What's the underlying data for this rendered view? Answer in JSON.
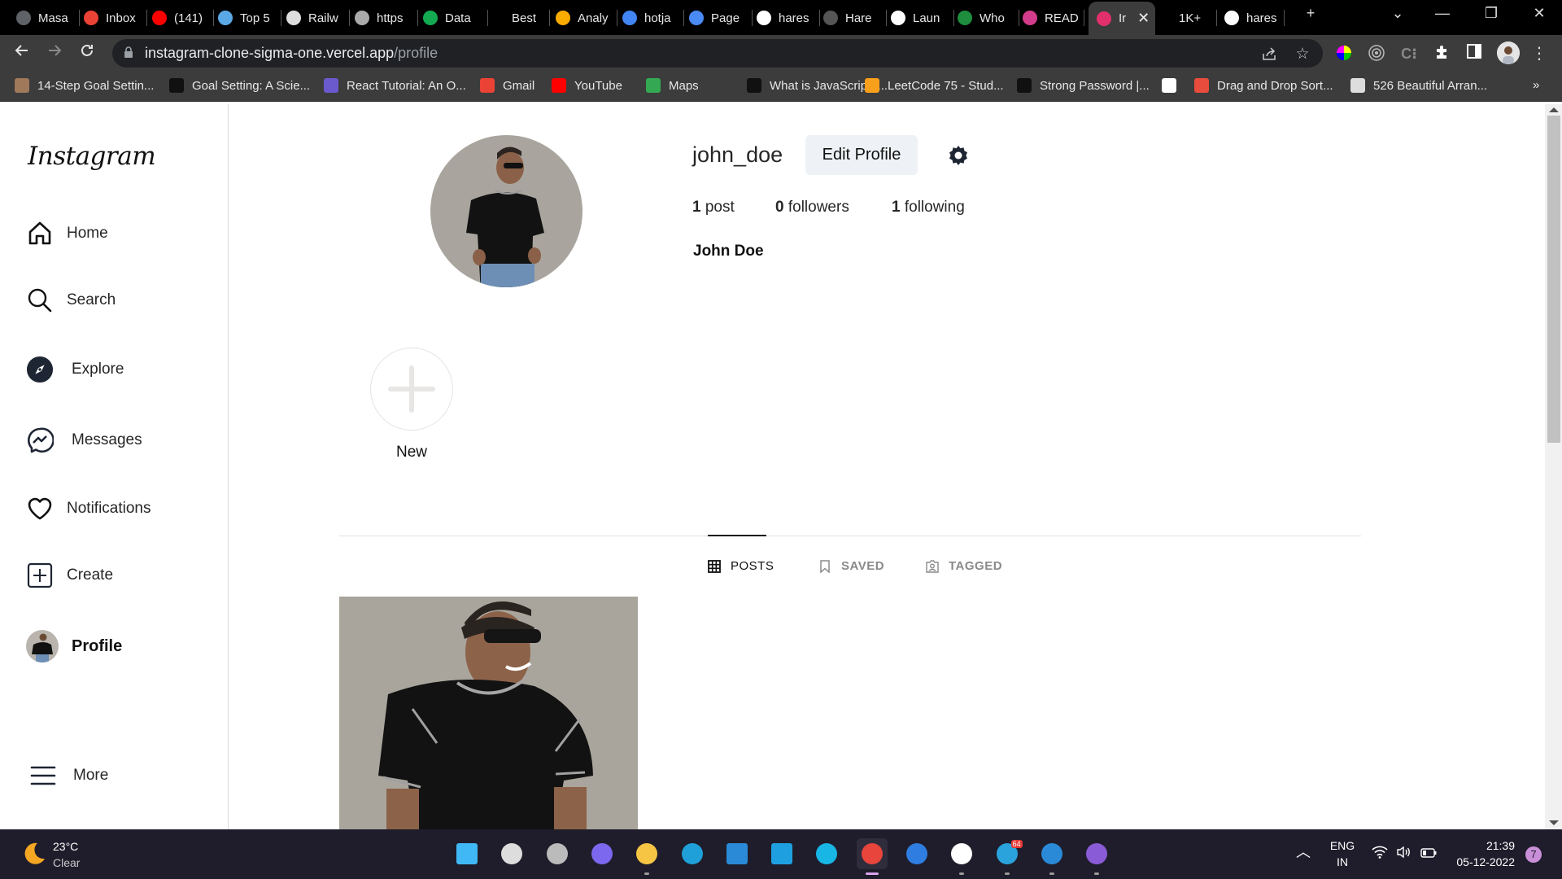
{
  "browser": {
    "tabs": [
      {
        "label": "Masa",
        "icon": "globe-icon",
        "color": "#5f6368"
      },
      {
        "label": "Inbox",
        "icon": "gmail-icon",
        "color": "#ea4335"
      },
      {
        "label": "(141)",
        "icon": "youtube-icon",
        "color": "#ff0000"
      },
      {
        "label": "Top 5",
        "icon": "mountain-icon",
        "color": "#5aa9e6"
      },
      {
        "label": "Railw",
        "icon": "railway-icon",
        "color": "#ddd"
      },
      {
        "label": "https",
        "icon": "film-reel-icon",
        "color": "#aaa"
      },
      {
        "label": "Data",
        "icon": "mongodb-leaf-icon",
        "color": "#13aa52"
      },
      {
        "label": "Best",
        "icon": "blank-icon",
        "color": "#000"
      },
      {
        "label": "Analy",
        "icon": "analytics-icon",
        "color": "#f9ab00"
      },
      {
        "label": "hotja",
        "icon": "google-icon",
        "color": "#4285f4"
      },
      {
        "label": "Page",
        "icon": "pagespeed-icon",
        "color": "#4a8af4"
      },
      {
        "label": "hares",
        "icon": "github-icon",
        "color": "#fff"
      },
      {
        "label": "Hare",
        "icon": "hashnode-icon",
        "color": "#555"
      },
      {
        "label": "Laun",
        "icon": "m-logo-icon",
        "color": "#fff"
      },
      {
        "label": "Who",
        "icon": "plus-cross-icon",
        "color": "#1e8e3e"
      },
      {
        "label": "READ",
        "icon": "readme-icon",
        "color": "#d33c8a"
      },
      {
        "label": "Ir",
        "icon": "instagram-icon",
        "color": "#e1306c",
        "active": true
      },
      {
        "label": "1K+",
        "icon": "blank-icon",
        "color": "#000"
      },
      {
        "label": "hares",
        "icon": "github-icon",
        "color": "#fff"
      }
    ],
    "new_tab": "+",
    "tab_search": "⌄",
    "window_controls": {
      "minimize": "—",
      "maximize": "❐",
      "close": "✕"
    },
    "url_host": "instagram-clone-sigma-one.vercel.app",
    "url_path": "/profile",
    "bookmarks": [
      {
        "label": "14-Step Goal Settin...",
        "icon": "person-photo-icon",
        "color": "#a0785a"
      },
      {
        "label": "Goal Setting: A Scie...",
        "icon": "jc-logo-icon",
        "color": "#111"
      },
      {
        "label": "React Tutorial: An O...",
        "icon": "floppy-disk-icon",
        "color": "#6a5acd"
      },
      {
        "label": "Gmail",
        "icon": "gmail-icon",
        "color": "#ea4335"
      },
      {
        "label": "YouTube",
        "icon": "youtube-icon",
        "color": "#ff0000"
      },
      {
        "label": "Maps",
        "icon": "maps-pin-icon",
        "color": "#34a853"
      },
      {
        "label": "What is JavaScript?...",
        "icon": "m-italic-icon",
        "color": "#111"
      },
      {
        "label": "LeetCode 75 - Stud...",
        "icon": "leetcode-icon",
        "color": "#f89f1b"
      },
      {
        "label": "Strong Password |...",
        "icon": "hi-logo-icon",
        "color": "#111"
      },
      {
        "label": "",
        "icon": "github-icon",
        "color": "#fff"
      },
      {
        "label": "Drag and Drop Sort...",
        "icon": "box-icon",
        "color": "#e74c3c"
      },
      {
        "label": "526 Beautiful Arran...",
        "icon": "globe-icon",
        "color": "#ddd"
      }
    ],
    "bookmarks_overflow": "»"
  },
  "sidebar": {
    "logo": "Instagram",
    "items": [
      {
        "label": "Home",
        "icon": "home-icon"
      },
      {
        "label": "Search",
        "icon": "search-icon"
      },
      {
        "label": "Explore",
        "icon": "compass-icon"
      },
      {
        "label": "Messages",
        "icon": "messenger-icon"
      },
      {
        "label": "Notifications",
        "icon": "heart-icon"
      },
      {
        "label": "Create",
        "icon": "plus-square-icon"
      },
      {
        "label": "Profile",
        "icon": "avatar",
        "active": true
      }
    ],
    "more": {
      "label": "More",
      "icon": "hamburger-menu-icon"
    }
  },
  "profile": {
    "username": "john_doe",
    "edit_button": "Edit Profile",
    "stats": {
      "posts_count": "1",
      "posts_label": "post",
      "followers_count": "0",
      "followers_label": "followers",
      "following_count": "1",
      "following_label": "following"
    },
    "full_name": "John Doe",
    "story_new_label": "New",
    "tabs": [
      {
        "label": "POSTS",
        "icon": "grid-icon",
        "active": true
      },
      {
        "label": "SAVED",
        "icon": "bookmark-icon",
        "active": false
      },
      {
        "label": "TAGGED",
        "icon": "tagged-person-icon",
        "active": false
      }
    ],
    "posts": [
      {
        "alt": "Man in black t-shirt and sunglasses smiling against a grey wall"
      }
    ]
  },
  "taskbar": {
    "weather": {
      "temp": "23°C",
      "condition": "Clear"
    },
    "apps": [
      "windows-start-icon",
      "search-icon",
      "task-view-icon",
      "teams-chat-icon",
      "file-explorer-icon",
      "edge-icon",
      "mail-icon",
      "l-app-icon",
      "alexa-icon",
      "chrome-icon",
      "todo-check-icon",
      "slack-icon",
      "telegram-icon",
      "vscode-icon",
      "github-desktop-icon"
    ],
    "telegram_badge": "64",
    "language": {
      "line1": "ENG",
      "line2": "IN"
    },
    "time": "21:39",
    "date": "05-12-2022",
    "notification_count": "7"
  }
}
